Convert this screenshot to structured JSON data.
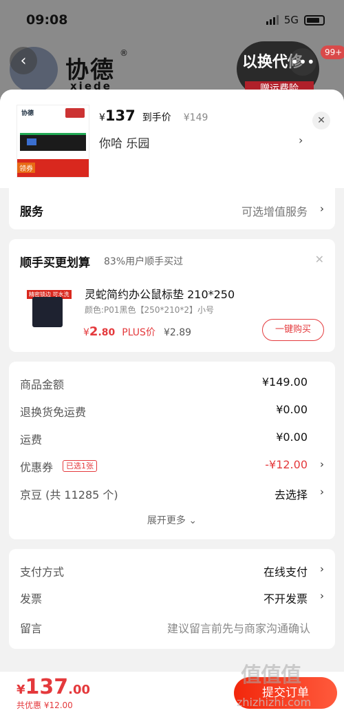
{
  "status_bar": {
    "time": "09:08",
    "network": "5G"
  },
  "background_page": {
    "brand_name": "协德",
    "brand_mark": "®",
    "brand_sub": "xiede",
    "promo_text": "以换代修",
    "promo_sub": "赠运费险",
    "cart_count": "99+"
  },
  "product": {
    "currency": "¥",
    "price": "137",
    "price_label": "到手价",
    "original_price": "¥149",
    "spec": "你哈  乐园",
    "thumb_brand": "协德",
    "thumb_tag": "领券"
  },
  "service": {
    "label": "服务",
    "value": "可选增值服务"
  },
  "bundle": {
    "title": "顺手买更划算",
    "subtitle": "83%用户顺手买过",
    "item": {
      "thumb_tag": "精密锁边 可水洗",
      "name": "灵蛇简约办公鼠标垫  210*250",
      "spec": "颜色:P01黑色【250*210*2】小号",
      "price_currency": "¥",
      "price_int": "2",
      "price_dec": ".80",
      "plus_label": "PLUS价",
      "plus_price": "¥2.89",
      "buy_label": "一键购买"
    }
  },
  "cost": {
    "rows": [
      {
        "label": "商品金额",
        "value": "¥149.00"
      },
      {
        "label": "退换货免运费",
        "value": "¥0.00"
      },
      {
        "label": "运费",
        "value": "¥0.00"
      },
      {
        "label": "优惠券",
        "tag": "已选1张",
        "value": "-¥12.00"
      },
      {
        "label": "京豆 (共 11285 个)",
        "value": "去选择"
      }
    ],
    "expand_label": "展开更多 ⌄"
  },
  "payment": {
    "rows": [
      {
        "label": "支付方式",
        "value": "在线支付"
      },
      {
        "label": "发票",
        "value": "不开发票"
      },
      {
        "label": "留言",
        "value": "建议留言前先与商家沟通确认"
      }
    ]
  },
  "footer": {
    "currency": "¥",
    "total_int": "137",
    "total_dec": ".00",
    "saving": "共优惠 ¥12.00",
    "submit_label": "提交订单"
  },
  "watermark": {
    "text": "值值值",
    "sub": "zhizhizhi.com"
  },
  "colors": {
    "accent": "#e4393c",
    "background": "#f2f2f2",
    "card": "#ffffff"
  }
}
